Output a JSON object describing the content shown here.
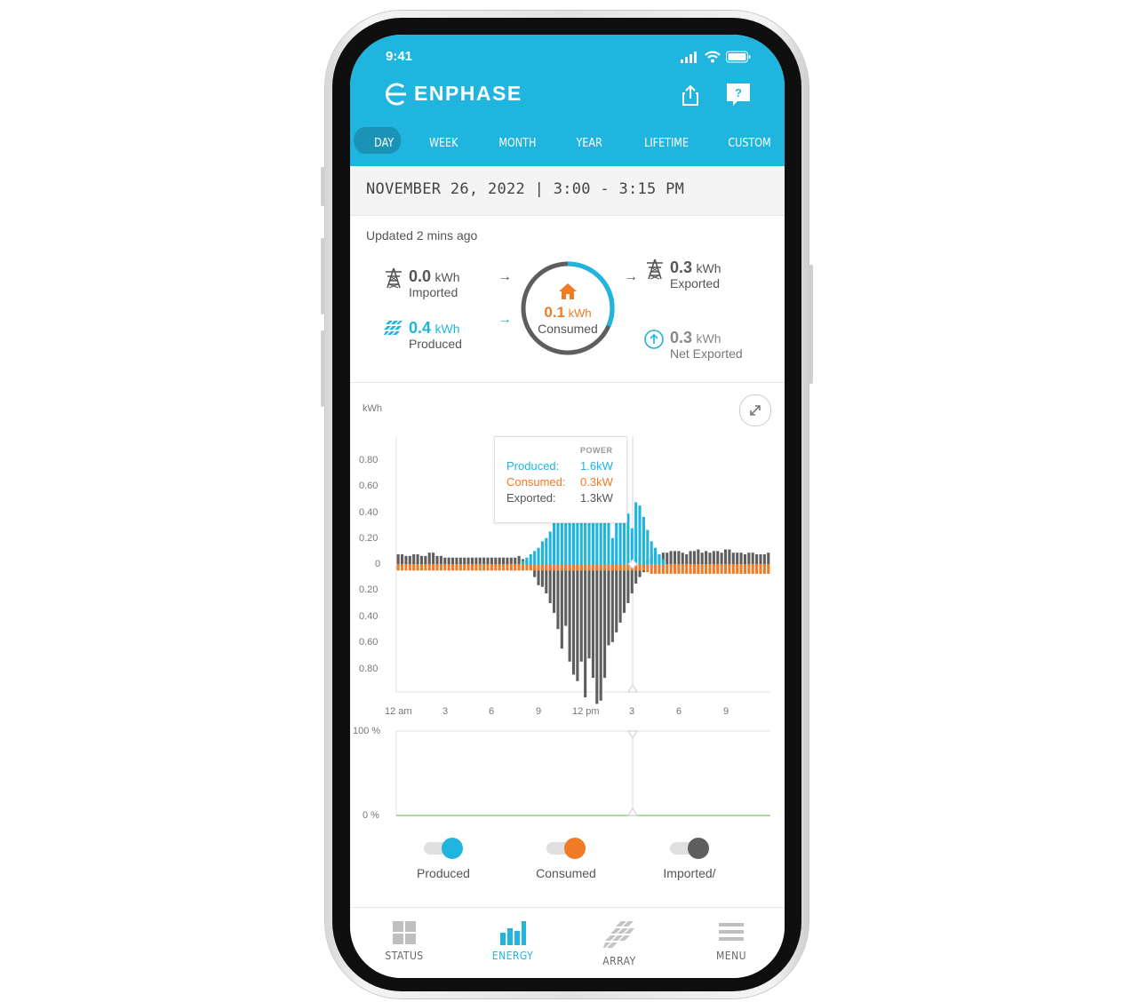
{
  "status_bar": {
    "time": "9:41"
  },
  "header": {
    "brand": "ENPHASE",
    "share_icon": "share-icon",
    "help_icon": "help-icon"
  },
  "tabs": [
    {
      "label": "DAY",
      "active": true
    },
    {
      "label": "WEEK"
    },
    {
      "label": "MONTH"
    },
    {
      "label": "YEAR"
    },
    {
      "label": "LIFETIME"
    },
    {
      "label": "CUSTOM"
    }
  ],
  "date_range": "NOVEMBER 26, 2022 | 3:00 - 3:15 PM",
  "updated": "Updated 2 mins ago",
  "summary": {
    "imported": {
      "value": "0.0",
      "unit": "kWh",
      "label": "Imported"
    },
    "produced": {
      "value": "0.4",
      "unit": "kWh",
      "label": "Produced"
    },
    "consumed": {
      "value": "0.1",
      "unit": "kWh",
      "label": "Consumed"
    },
    "exported": {
      "value": "0.3",
      "unit": "kWh",
      "label": "Exported"
    },
    "net_exported": {
      "value": "0.3",
      "unit": "kWh",
      "label": "Net Exported"
    }
  },
  "colors": {
    "primary": "#1fb5de",
    "produced": "#1fb5de",
    "consumed": "#f07b26",
    "imported": "#5e5e60"
  },
  "chart": {
    "unit_label": "kWh",
    "y_ticks_top": [
      "0.80",
      "0.60",
      "0.40",
      "0.20",
      "0"
    ],
    "y_ticks_bottom": [
      "0.20",
      "0.40",
      "0.60",
      "0.80"
    ],
    "x_ticks": [
      "12 am",
      "3",
      "6",
      "9",
      "12 pm",
      "3",
      "6",
      "9"
    ],
    "tooltip": {
      "title": "POWER",
      "produced_label": "Produced:",
      "produced_value": "1.6kW",
      "consumed_label": "Consumed:",
      "consumed_value": "0.3kW",
      "exported_label": "Exported:",
      "exported_value": "1.3kW"
    }
  },
  "chart_data": {
    "type": "bar",
    "title": "",
    "ylabel": "kWh",
    "x_start_hour": 0,
    "x_end_hour": 24,
    "ylim": [
      -0.85,
      0.85
    ],
    "legend": "bottom",
    "series": [
      {
        "name": "Produced",
        "color": "#1fb5de",
        "x": [
          8,
          8.25,
          8.5,
          8.75,
          9,
          9.25,
          9.5,
          9.75,
          10,
          10.25,
          10.5,
          10.75,
          11,
          11.25,
          11.5,
          11.75,
          12,
          12.25,
          12.5,
          12.75,
          13,
          13.25,
          13.5,
          13.75,
          14,
          14.25,
          14.5,
          14.75,
          15,
          15.25,
          15.5,
          15.75,
          16,
          16.25,
          16.5,
          16.75,
          17
        ],
        "values": [
          0.02,
          0.04,
          0.06,
          0.08,
          0.1,
          0.14,
          0.16,
          0.2,
          0.26,
          0.31,
          0.31,
          0.31,
          0.31,
          0.31,
          0.31,
          0.31,
          0.31,
          0.31,
          0.31,
          0.31,
          0.31,
          0.31,
          0.31,
          0.16,
          0.31,
          0.31,
          0.31,
          0.31,
          0.22,
          0.38,
          0.36,
          0.29,
          0.21,
          0.14,
          0.1,
          0.06,
          0.03
        ]
      },
      {
        "name": "Consumed",
        "color": "#f07b26",
        "x": [
          0,
          0.25,
          0.5,
          0.75,
          1,
          1.25,
          1.5,
          1.75,
          2,
          2.25,
          2.5,
          2.75,
          3,
          3.25,
          3.5,
          3.75,
          4,
          4.25,
          4.5,
          4.75,
          5,
          5.25,
          5.5,
          5.75,
          6,
          6.25,
          6.5,
          6.75,
          7,
          7.25,
          7.5,
          7.75,
          8,
          8.25,
          8.5,
          8.75,
          9,
          9.25,
          9.5,
          9.75,
          10,
          10.25,
          10.5,
          10.75,
          11,
          11.25,
          11.5,
          11.75,
          12,
          12.25,
          12.5,
          12.75,
          13,
          13.25,
          13.5,
          13.75,
          14,
          14.25,
          14.5,
          14.75,
          15,
          15.25,
          15.5,
          15.75,
          16,
          16.25,
          16.5,
          16.75,
          17,
          17.25,
          17.5,
          17.75,
          18,
          18.25,
          18.5,
          18.75,
          19,
          19.25,
          19.5,
          19.75,
          20,
          20.25,
          20.5,
          20.75,
          21,
          21.25,
          21.5,
          21.75,
          22,
          22.25,
          22.5,
          22.75,
          23,
          23.25,
          23.5,
          23.75
        ],
        "values": [
          -0.04,
          -0.04,
          -0.04,
          -0.04,
          -0.04,
          -0.04,
          -0.04,
          -0.04,
          -0.04,
          -0.04,
          -0.04,
          -0.04,
          -0.04,
          -0.04,
          -0.04,
          -0.04,
          -0.04,
          -0.04,
          -0.04,
          -0.04,
          -0.04,
          -0.04,
          -0.04,
          -0.04,
          -0.04,
          -0.04,
          -0.04,
          -0.04,
          -0.04,
          -0.04,
          -0.04,
          -0.04,
          -0.04,
          -0.04,
          -0.04,
          -0.04,
          -0.04,
          -0.04,
          -0.04,
          -0.04,
          -0.04,
          -0.04,
          -0.04,
          -0.04,
          -0.04,
          -0.04,
          -0.04,
          -0.04,
          -0.04,
          -0.04,
          -0.04,
          -0.04,
          -0.04,
          -0.04,
          -0.04,
          -0.04,
          -0.04,
          -0.04,
          -0.04,
          -0.04,
          -0.04,
          -0.04,
          -0.04,
          -0.04,
          -0.05,
          -0.06,
          -0.06,
          -0.06,
          -0.06,
          -0.06,
          -0.06,
          -0.06,
          -0.06,
          -0.06,
          -0.06,
          -0.06,
          -0.06,
          -0.06,
          -0.06,
          -0.06,
          -0.06,
          -0.06,
          -0.06,
          -0.06,
          -0.06,
          -0.06,
          -0.06,
          -0.06,
          -0.06,
          -0.06,
          -0.06,
          -0.06,
          -0.06,
          -0.06,
          -0.06,
          -0.06
        ]
      },
      {
        "name": "Imported/Exported",
        "color": "#5e5e60",
        "x": [
          0,
          0.25,
          0.5,
          0.75,
          1,
          1.25,
          1.5,
          1.75,
          2,
          2.25,
          2.5,
          2.75,
          3,
          3.25,
          3.5,
          3.75,
          4,
          4.25,
          4.5,
          4.75,
          5,
          5.25,
          5.5,
          5.75,
          6,
          6.25,
          6.5,
          6.75,
          7,
          7.25,
          7.5,
          7.75,
          8,
          8.25,
          8.5,
          8.75,
          9,
          9.25,
          9.5,
          9.75,
          10,
          10.25,
          10.5,
          10.75,
          11,
          11.25,
          11.5,
          11.75,
          12,
          12.25,
          12.5,
          12.75,
          13,
          13.25,
          13.5,
          13.75,
          14,
          14.25,
          14.5,
          14.75,
          15,
          15.25,
          15.5,
          15.75,
          16,
          16.25,
          16.5,
          16.75,
          17,
          17.25,
          17.5,
          17.75,
          18,
          18.25,
          18.5,
          18.75,
          19,
          19.25,
          19.5,
          19.75,
          20,
          20.25,
          20.5,
          20.75,
          21,
          21.25,
          21.5,
          21.75,
          22,
          22.25,
          22.5,
          22.75,
          23,
          23.25,
          23.5,
          23.75
        ],
        "values": [
          0.06,
          0.06,
          0.05,
          0.05,
          0.06,
          0.06,
          0.05,
          0.05,
          0.07,
          0.07,
          0.05,
          0.05,
          0.04,
          0.04,
          0.04,
          0.04,
          0.04,
          0.04,
          0.04,
          0.04,
          0.04,
          0.04,
          0.04,
          0.04,
          0.04,
          0.04,
          0.04,
          0.04,
          0.04,
          0.04,
          0.04,
          0.05,
          0.03,
          0.02,
          -0.03,
          -0.08,
          -0.13,
          -0.14,
          -0.18,
          -0.24,
          -0.3,
          -0.4,
          -0.52,
          -0.38,
          -0.6,
          -0.68,
          -0.72,
          -0.6,
          -0.82,
          -0.58,
          -0.7,
          -0.86,
          -0.84,
          -0.7,
          -0.5,
          -0.48,
          -0.42,
          -0.36,
          -0.3,
          -0.24,
          -0.18,
          -0.12,
          -0.08,
          -0.05,
          0.03,
          0.05,
          0.06,
          0.06,
          0.07,
          0.07,
          0.08,
          0.08,
          0.08,
          0.07,
          0.06,
          0.08,
          0.08,
          0.09,
          0.07,
          0.08,
          0.07,
          0.08,
          0.08,
          0.07,
          0.09,
          0.09,
          0.07,
          0.07,
          0.07,
          0.06,
          0.07,
          0.07,
          0.06,
          0.06,
          0.06,
          0.07
        ]
      }
    ]
  },
  "soc_chart": {
    "y_top": "100 %",
    "y_bottom": "0 %"
  },
  "legend": [
    {
      "label": "Produced",
      "color": "#1fb5de"
    },
    {
      "label": "Consumed",
      "color": "#f07b26"
    },
    {
      "label": "Imported/",
      "color": "#5e5e60"
    }
  ],
  "bottom_nav": [
    {
      "label": "STATUS",
      "icon": "grid-icon"
    },
    {
      "label": "ENERGY",
      "icon": "bar-chart-icon",
      "active": true
    },
    {
      "label": "ARRAY",
      "icon": "solar-panel-icon"
    },
    {
      "label": "MENU",
      "icon": "menu-icon"
    }
  ]
}
